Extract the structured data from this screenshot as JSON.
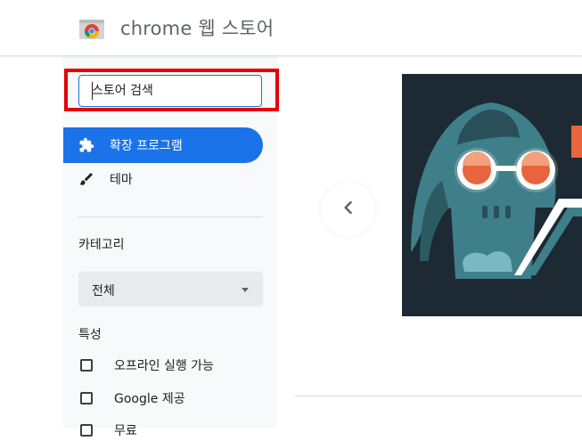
{
  "header": {
    "store_title": "chrome 웹 스토어",
    "logo_icon": "chrome-logo-icon"
  },
  "sidebar": {
    "search": {
      "placeholder": "스토어 검색",
      "value": ""
    },
    "nav": [
      {
        "label": "확장 프로그램",
        "icon": "puzzle-piece-icon",
        "active": true
      },
      {
        "label": "테마",
        "icon": "paintbrush-icon",
        "active": false
      }
    ],
    "category_heading": "카테고리",
    "category_select": {
      "selected": "전체"
    },
    "features_heading": "특성",
    "features": [
      {
        "label": "오프라인 실행 가능",
        "checked": false
      },
      {
        "label": "Google 제공",
        "checked": false
      },
      {
        "label": "무료",
        "checked": false
      }
    ]
  },
  "main": {
    "carousel_prev_icon": "chevron-left-icon",
    "banner_image": "dark-helmet-glasses-illustration"
  },
  "colors": {
    "accent": "#1a73e8",
    "highlight_box": "#e60000",
    "banner_bg": "#1d2a33",
    "banner_teal": "#3f7f8a",
    "banner_orange": "#e8643c"
  }
}
